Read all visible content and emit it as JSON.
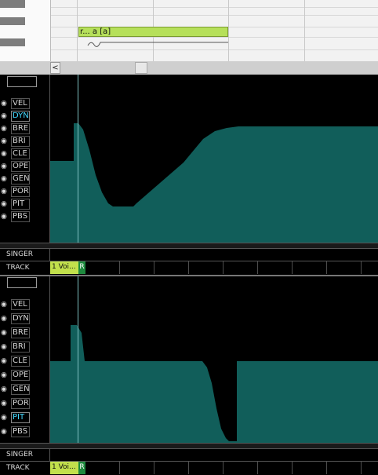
{
  "piano_roll": {
    "note_lyric": "r... a  [a]"
  },
  "scroll": {
    "left_arrow": "<"
  },
  "panels": [
    {
      "params": [
        "VEL",
        "DYN",
        "BRE",
        "BRI",
        "CLE",
        "OPE",
        "GEN",
        "POR",
        "PIT",
        "PBS"
      ],
      "active": "DYN",
      "singer_label": "SINGER",
      "track_label": "TRACK",
      "track_clip": "1 Voi...",
      "record_button": "R"
    },
    {
      "params": [
        "VEL",
        "DYN",
        "BRE",
        "BRI",
        "CLE",
        "OPE",
        "GEN",
        "POR",
        "PIT",
        "PBS"
      ],
      "active": "PIT",
      "singer_label": "SINGER",
      "track_label": "TRACK",
      "track_clip": "1 Voi...",
      "record_button": "R"
    }
  ],
  "colors": {
    "curve_fill": "#115e5a",
    "note_fill": "#b6e05a",
    "active_param": "#44d8ff",
    "track_clip": "#c2e04c",
    "record": "#1e8a3e"
  }
}
